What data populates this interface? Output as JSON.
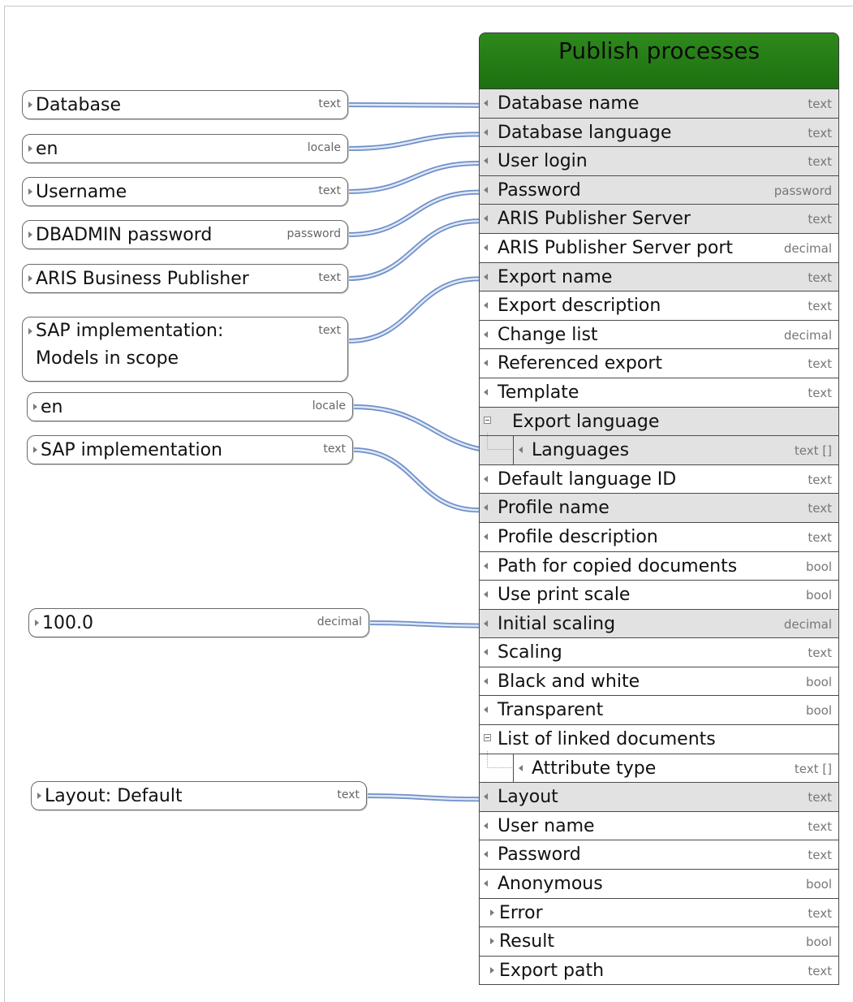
{
  "function": {
    "title": "Publish processes",
    "rows": [
      {
        "label": "Database name",
        "type": "text",
        "kind": "in",
        "hl": true
      },
      {
        "label": "Database language",
        "type": "text",
        "kind": "in",
        "hl": true
      },
      {
        "label": "User login",
        "type": "text",
        "kind": "in",
        "hl": true
      },
      {
        "label": "Password",
        "type": "password",
        "kind": "in",
        "hl": true
      },
      {
        "label": "ARIS Publisher Server",
        "type": "text",
        "kind": "in",
        "hl": true
      },
      {
        "label": "ARIS Publisher Server port",
        "type": "decimal",
        "kind": "in",
        "hl": false
      },
      {
        "label": "Export name",
        "type": "text",
        "kind": "in",
        "hl": true
      },
      {
        "label": "Export description",
        "type": "text",
        "kind": "in",
        "hl": false
      },
      {
        "label": "Change list",
        "type": "decimal",
        "kind": "in",
        "hl": false
      },
      {
        "label": "Referenced export",
        "type": "text",
        "kind": "in",
        "hl": false
      },
      {
        "label": "Template",
        "type": "text",
        "kind": "in",
        "hl": false
      },
      {
        "label": "Export language",
        "type": "",
        "kind": "group",
        "hl": true
      },
      {
        "label": "Languages",
        "type": "text []",
        "kind": "sub",
        "hl": true
      },
      {
        "label": "Default language ID",
        "type": "text",
        "kind": "in",
        "hl": false
      },
      {
        "label": "Profile name",
        "type": "text",
        "kind": "in",
        "hl": true
      },
      {
        "label": "Profile description",
        "type": "text",
        "kind": "in",
        "hl": false
      },
      {
        "label": "Path for copied documents",
        "type": "bool",
        "kind": "in",
        "hl": false
      },
      {
        "label": "Use print scale",
        "type": "bool",
        "kind": "in",
        "hl": false
      },
      {
        "label": "Initial scaling",
        "type": "decimal",
        "kind": "in",
        "hl": true
      },
      {
        "label": "Scaling",
        "type": "text",
        "kind": "in",
        "hl": false
      },
      {
        "label": "Black and white",
        "type": "bool",
        "kind": "in",
        "hl": false
      },
      {
        "label": "Transparent",
        "type": "bool",
        "kind": "in",
        "hl": false
      },
      {
        "label": "List of linked documents",
        "type": "",
        "kind": "group2",
        "hl": false
      },
      {
        "label": "Attribute type",
        "type": "text []",
        "kind": "sub",
        "hl": false
      },
      {
        "label": "Layout",
        "type": "text",
        "kind": "in",
        "hl": true
      },
      {
        "label": "User name",
        "type": "text",
        "kind": "in",
        "hl": false
      },
      {
        "label": "Password",
        "type": "text",
        "kind": "in",
        "hl": false
      },
      {
        "label": "Anonymous",
        "type": "bool",
        "kind": "in",
        "hl": false
      },
      {
        "label": "Error",
        "type": "text",
        "kind": "out",
        "hl": false
      },
      {
        "label": "Result",
        "type": "bool",
        "kind": "out",
        "hl": false
      },
      {
        "label": "Export path",
        "type": "text",
        "kind": "out",
        "hl": false
      }
    ]
  },
  "inputs": [
    {
      "value": "Database",
      "type": "text",
      "target_row": 0
    },
    {
      "value": "en",
      "type": "locale",
      "target_row": 1
    },
    {
      "value": "Username",
      "type": "text",
      "target_row": 2
    },
    {
      "value": "DBADMIN password",
      "type": "password",
      "target_row": 3
    },
    {
      "value": "ARIS Business Publisher",
      "type": "text",
      "target_row": 4
    },
    {
      "value": "SAP implementation:\nModels in scope",
      "type": "text",
      "target_row": 6
    },
    {
      "value": "en",
      "type": "locale",
      "target_row": 12
    },
    {
      "value": "SAP implementation",
      "type": "text",
      "target_row": 14
    },
    {
      "value": "100.0",
      "type": "decimal",
      "target_row": 18
    },
    {
      "value": "Layout: Default",
      "type": "text",
      "target_row": 24
    }
  ],
  "colors": {
    "header": "#1d6f10",
    "wire": "#6f8fc8",
    "wire_inner": "#dfe8f8",
    "row_highlight": "#e2e2e2"
  }
}
